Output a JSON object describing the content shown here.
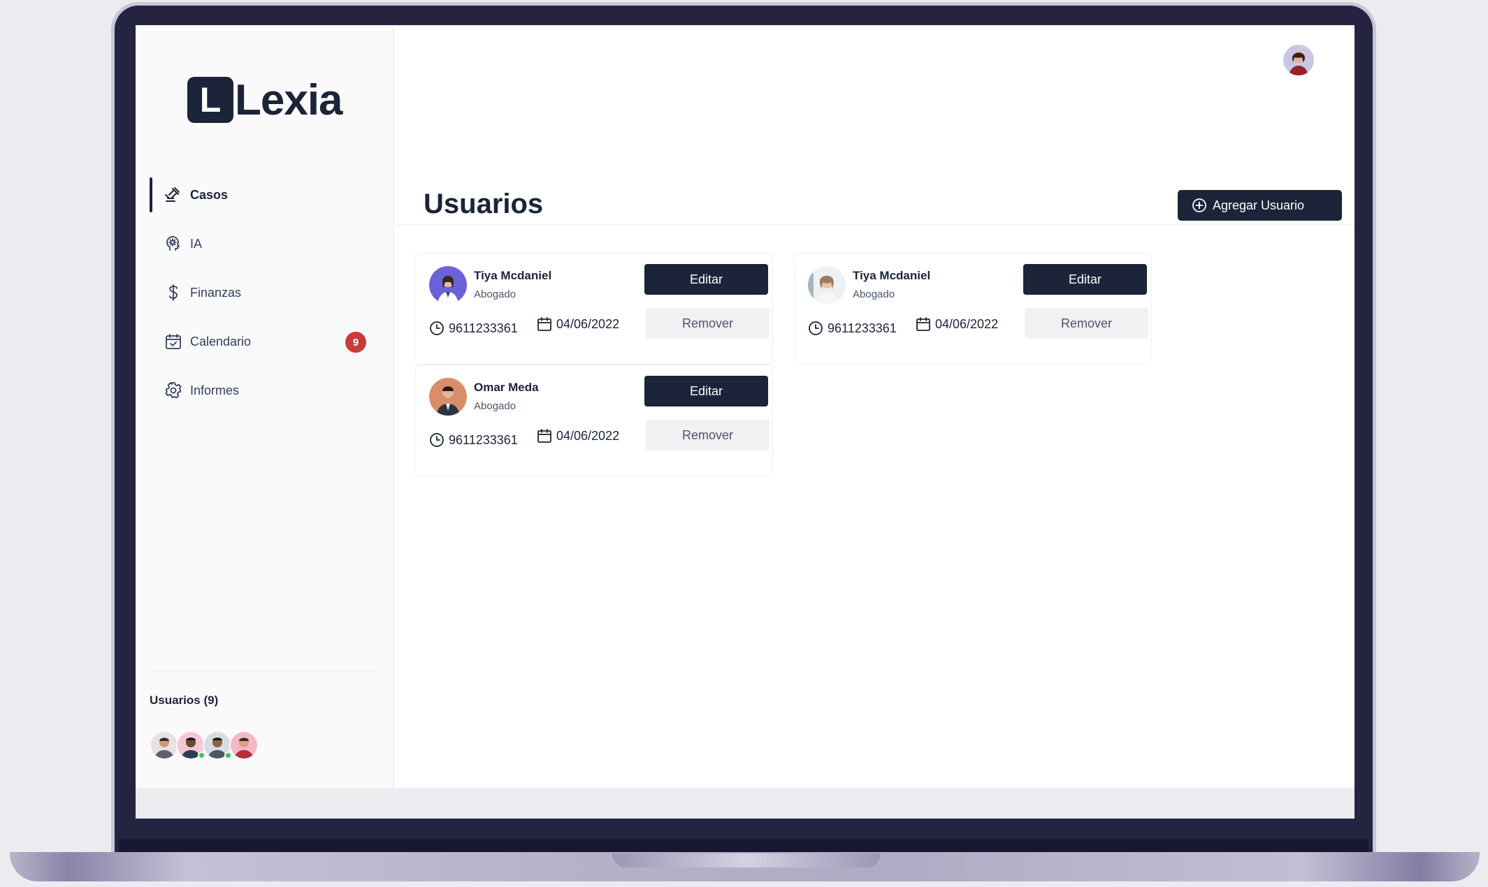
{
  "brand": {
    "logo_letter": "L",
    "name": "Lexia"
  },
  "sidebar": {
    "items": [
      {
        "label": "Casos",
        "icon": "gavel-icon",
        "active": true
      },
      {
        "label": "IA",
        "icon": "ai-brain-icon"
      },
      {
        "label": "Finanzas",
        "icon": "dollar-icon"
      },
      {
        "label": "Calendario",
        "icon": "calendar-check-icon",
        "badge": "9"
      },
      {
        "label": "Informes",
        "icon": "gear-icon"
      }
    ],
    "users_title": "Usuarios (9)"
  },
  "header": {
    "title": "Usuarios",
    "add_button_label": "Agregar Usuario"
  },
  "cards": [
    {
      "name": "Tiya Mcdaniel",
      "role": "Abogado",
      "phone": "9611233361",
      "date": "04/06/2022",
      "edit_label": "Editar",
      "remove_label": "Remover"
    },
    {
      "name": "Tiya Mcdaniel",
      "role": "Abogado",
      "phone": "9611233361",
      "date": "04/06/2022",
      "edit_label": "Editar",
      "remove_label": "Remover"
    },
    {
      "name": "Omar Meda",
      "role": "Abogado",
      "phone": "9611233361",
      "date": "04/06/2022",
      "edit_label": "Editar",
      "remove_label": "Remover"
    }
  ],
  "colors": {
    "primary": "#1b2438",
    "badge": "#c73b3b",
    "online": "#3cc25f",
    "frame": "#242340"
  }
}
